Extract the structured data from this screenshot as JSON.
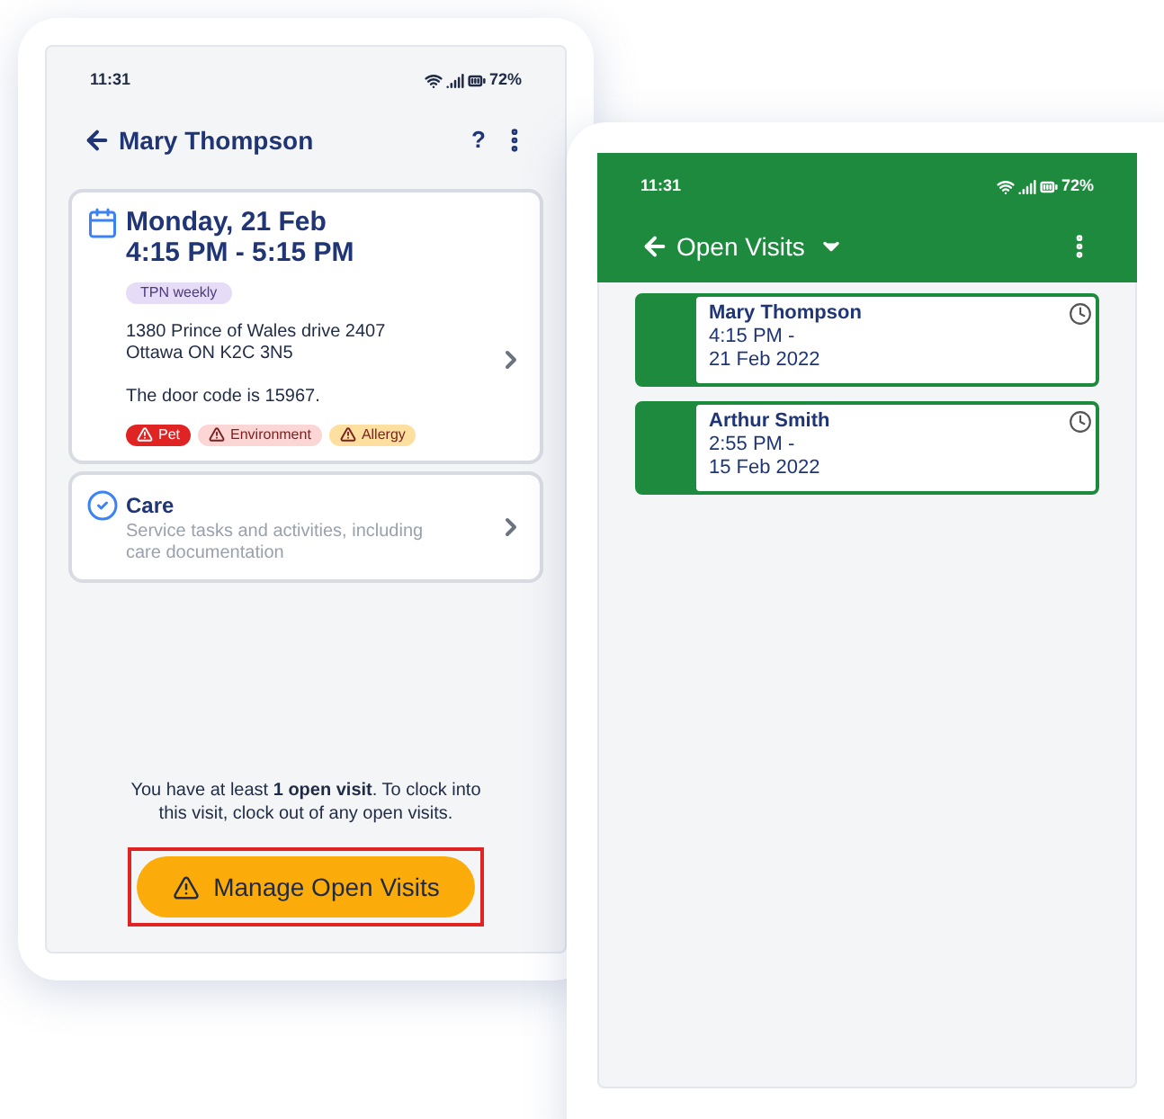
{
  "left_phone": {
    "status_bar": {
      "time": "11:31",
      "battery": "72%"
    },
    "header": {
      "title": "Mary Thompson",
      "help": "?"
    },
    "visit_card": {
      "date": "Monday, 21 Feb",
      "time": "4:15 PM - 5:15 PM",
      "badge": "TPN weekly",
      "address": [
        "1380 Prince of Wales drive 2407",
        "Ottawa ON K2C 3N5"
      ],
      "note": "The door code is 15967.",
      "tags": [
        {
          "label": "Pet",
          "color": "#e02424"
        },
        {
          "label": "Environment",
          "color": "#fcd5d5"
        },
        {
          "label": "Allergy",
          "color": "#fde0a0"
        }
      ]
    },
    "care_card": {
      "title": "Care",
      "subtitle": "Service tasks and activities, including care documentation"
    },
    "message": "You have at least **1 open visit**. To clock into this visit, clock out of any open visits.",
    "button": {
      "label": "Manage Open Visits",
      "highlighted": true
    }
  },
  "right_phone": {
    "status_bar": {
      "time": "11:31",
      "battery": "72%"
    },
    "header": {
      "title": "Open Visits"
    },
    "visits": [
      {
        "name": "Mary Thompson",
        "time": "4:15 PM -",
        "date": "21 Feb 2022"
      },
      {
        "name": "Arthur Smith",
        "time": "2:55 PM -",
        "date": "15 Feb 2022"
      }
    ]
  }
}
